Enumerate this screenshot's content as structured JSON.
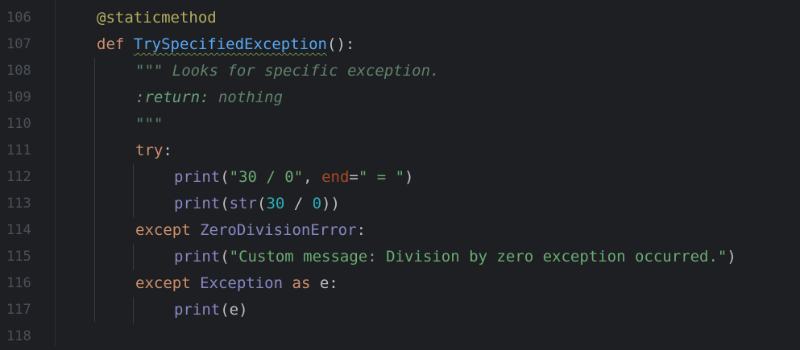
{
  "line_numbers": [
    "106",
    "107",
    "108",
    "109",
    "110",
    "111",
    "112",
    "113",
    "114",
    "115",
    "116",
    "117",
    "118"
  ],
  "code": {
    "l106": {
      "decorator": "@staticmethod"
    },
    "l107": {
      "kw": "def",
      "name": "TrySpecifiedException",
      "rest": "():"
    },
    "l108": {
      "doc": "\"\"\" Looks for specific exception."
    },
    "l109": {
      "tag": ":return:",
      "doc": " nothing"
    },
    "l110": {
      "doc": "\"\"\""
    },
    "l111": {
      "kw": "try",
      "rest": ":"
    },
    "l112": {
      "fn": "print",
      "p1": "(",
      "s1": "\"30 / 0\"",
      "comma": ", ",
      "param": "end",
      "eq": "=",
      "s2": "\" = \"",
      "close": ")"
    },
    "l113": {
      "fn": "print",
      "p1": "(",
      "fn2": "str",
      "p2": "(",
      "n1": "30",
      "op": " / ",
      "n2": "0",
      "close": "))"
    },
    "l114": {
      "kw": "except",
      "cls": "ZeroDivisionError",
      "rest": ":"
    },
    "l115": {
      "fn": "print",
      "p1": "(",
      "s1": "\"Custom message: Division by zero exception occurred.\"",
      "close": ")"
    },
    "l116": {
      "kw": "except",
      "cls": "Exception",
      "kw2": "as",
      "var": "e",
      "rest": ":"
    },
    "l117": {
      "fn": "print",
      "p1": "(",
      "var": "e",
      "close": ")"
    }
  }
}
